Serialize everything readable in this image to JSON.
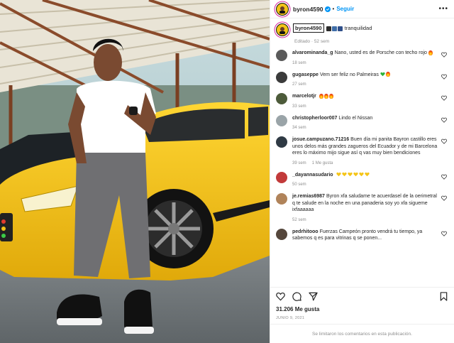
{
  "post": {
    "username": "byron4590",
    "follow_label": "Seguir",
    "more_label": "•••"
  },
  "caption": {
    "username": "byron4590",
    "text": "tranquilidad",
    "meta": "Editado · 52 sem"
  },
  "comments": [
    {
      "user": "alvarominanda_g",
      "text": "Nano, usted es de Porsche con techo rojo",
      "emoji": "fire",
      "time": "18 sem",
      "likes": "",
      "avatar_color": "#5a5a5a"
    },
    {
      "user": "gugaseppe",
      "text": "Vem ser feliz no Palmeiras",
      "emoji": "green-heart-fire",
      "time": "27 sem",
      "likes": "",
      "avatar_color": "#3b3b3b"
    },
    {
      "user": "marcelotjr",
      "text": "",
      "emoji": "fire-x3",
      "time": "33 sem",
      "likes": "",
      "avatar_color": "#4d5b3a"
    },
    {
      "user": "christopherloor007",
      "text": "Lindo el Nissan",
      "emoji": "",
      "time": "34 sem",
      "likes": "",
      "avatar_color": "#9aa4a8"
    },
    {
      "user": "josue.campuzano.71216",
      "text": "Buen día mi panita Bayron castillo eres unos delos más grandes zagueros del Ecuador y de mi Barcelona eres lo máximo mijo sigue así q vas muy bien bendiciones",
      "emoji": "",
      "time": "39 sem",
      "likes": "1 Me gusta",
      "avatar_color": "#2f3a44"
    },
    {
      "user": "_dayannasudario",
      "text": "",
      "emoji": "yellow-hearts",
      "time": "50 sem",
      "likes": "",
      "avatar_color": "#c23a3a"
    },
    {
      "user": "je.remias6987",
      "text": "Byron xfa saludame te acuerdasel de la oerimetral q te salude en la noche en una panaderia soy yo xfa sigueme ixfaaaaaa",
      "emoji": "",
      "time": "52 sem",
      "likes": "",
      "avatar_color": "#b0835a"
    },
    {
      "user": "pedrhitooo",
      "text": "Fuerzas Campeón pronto vendrá tu tiempo, ya sabemos q es para vitrinas q se ponen...",
      "emoji": "",
      "time": "",
      "likes": "",
      "avatar_color": "#55473c"
    }
  ],
  "footer": {
    "likes": "31.206 Me gusta",
    "date": "JUNIO 9, 2021",
    "limited": "Se limitaron los comentarios en esta publicación."
  },
  "colors": {
    "accent": "#0095f6",
    "heart_red": "#ed4956",
    "car_yellow": "#f3c316"
  },
  "icons": [
    "verified-icon",
    "more-icon",
    "heart-icon",
    "comment-icon",
    "share-icon",
    "save-icon"
  ]
}
